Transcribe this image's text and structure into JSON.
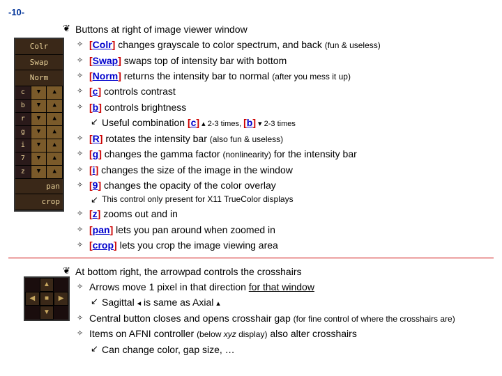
{
  "page_number": "-10-",
  "section1": {
    "title": "Buttons at right of image viewer window",
    "items": [
      {
        "btn": "Colr",
        "text": " changes grayscale to color spectrum, and back ",
        "note": "(fun & useless)"
      },
      {
        "btn": "Swap",
        "text": " swaps top of intensity bar with bottom",
        "note": ""
      },
      {
        "btn": "Norm",
        "text": " returns the intensity bar to normal ",
        "note": "(after you mess it up)"
      },
      {
        "btn": "c",
        "text": " controls contrast",
        "note": ""
      },
      {
        "btn": "b",
        "text": " controls brightness",
        "note": ""
      }
    ],
    "combo": {
      "pre": "Useful combination  ",
      "c_btn": "c",
      "mid1": " ▴ 2-3 times,  ",
      "b_btn": "b",
      "mid2": " ▾ 2-3 times"
    },
    "items2": [
      {
        "btn": "R",
        "text": " rotates the intensity bar ",
        "note": "(also fun & useless)"
      },
      {
        "btn": "g",
        "text": " changes the gamma factor ",
        "note": "(nonlinearity)",
        "post": " for the intensity bar"
      },
      {
        "btn": "i",
        "text": " changes the size of the image in the window",
        "note": ""
      },
      {
        "btn": "9",
        "text": " changes the opacity of the color overlay",
        "note": ""
      }
    ],
    "x11_note": "This control only present for X11 TrueColor displays",
    "items3": [
      {
        "btn": "z",
        "text": " zooms out and in",
        "note": ""
      },
      {
        "btn": "pan",
        "text": " lets you pan around when zoomed in",
        "note": ""
      },
      {
        "btn": "crop",
        "text": " lets you crop the image viewing area",
        "note": ""
      }
    ]
  },
  "section2": {
    "title": "At bottom right, the arrowpad controls the crosshairs",
    "arrow_line": {
      "pre": "Arrows move 1 pixel in that direction ",
      "underlined": "for that window"
    },
    "sagittal": {
      "pre": "Sagittal ",
      "a1": "◂",
      "mid": " is same as Axial ",
      "a2": "▴"
    },
    "central": {
      "text": "Central button closes and opens crosshair gap ",
      "note": "(for fine control of where the crosshairs are)"
    },
    "afni": {
      "pre": "Items on AFNI controller ",
      "note": "(below ",
      "xyz": "xyz",
      "note2": " display)",
      "post": " also alter crosshairs"
    },
    "change": "Can change color, gap size, …"
  },
  "toolbar": [
    "Colr",
    "Swap",
    "Norm"
  ],
  "toolbar_rows": [
    "c",
    "b",
    "r",
    "g",
    "i",
    "7",
    "z"
  ],
  "toolbar_bottom": [
    "pan",
    "crop"
  ]
}
